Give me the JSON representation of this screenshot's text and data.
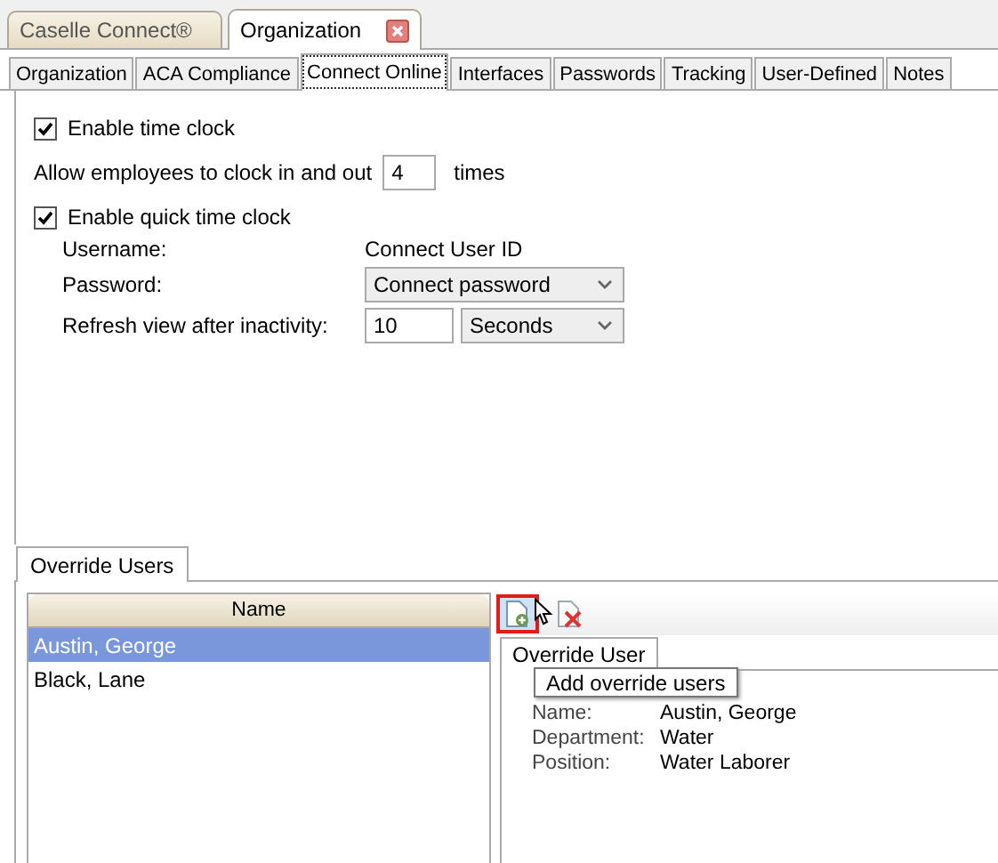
{
  "document_tabs": [
    {
      "label": "Caselle Connect®",
      "selected": false,
      "closable": false
    },
    {
      "label": "Organization",
      "selected": true,
      "closable": true
    }
  ],
  "tabs": [
    {
      "label": "Organization",
      "selected": false
    },
    {
      "label": "ACA Compliance",
      "selected": false
    },
    {
      "label": "Connect Online",
      "selected": true
    },
    {
      "label": "Interfaces",
      "selected": false
    },
    {
      "label": "Passwords",
      "selected": false
    },
    {
      "label": "Tracking",
      "selected": false
    },
    {
      "label": "User-Defined",
      "selected": false
    },
    {
      "label": "Notes",
      "selected": false
    }
  ],
  "time_clock": {
    "label": "Enable time clock",
    "checked": true,
    "allow_label": "Allow employees to clock in and out",
    "allow_value": "4",
    "allow_suffix": "times"
  },
  "quick_time_clock": {
    "label": "Enable quick time clock",
    "checked": true,
    "fields": [
      {
        "kind": "text",
        "label": "Username:",
        "value": "Connect User ID"
      },
      {
        "kind": "select",
        "label": "Password:",
        "value": "Connect password"
      },
      {
        "kind": "input_select",
        "label": "Refresh view after inactivity:",
        "value": "10",
        "unit": "Seconds"
      }
    ]
  },
  "override_users": {
    "tab": "Override Users",
    "column": "Name",
    "rows": [
      {
        "name": "Austin, George",
        "selected": true
      },
      {
        "name": "Black, Lane",
        "selected": false
      }
    ],
    "detail_tab": "Override User",
    "tooltip": "Add override users",
    "details": [
      {
        "label": "Name:",
        "value": "Austin, George"
      },
      {
        "label": "Department:",
        "value": "Water"
      },
      {
        "label": "Position:",
        "value": "Water Laborer"
      }
    ]
  }
}
